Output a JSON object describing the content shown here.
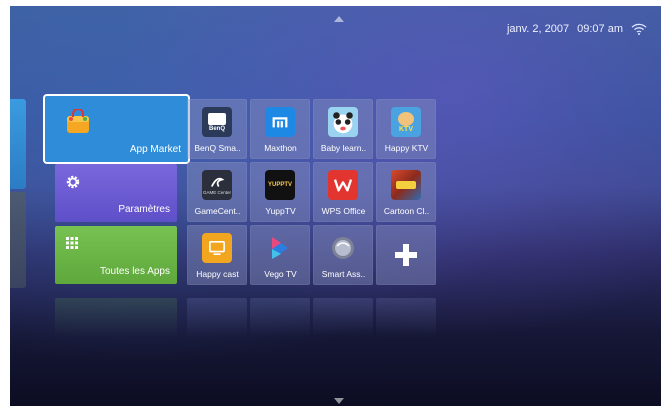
{
  "status_bar": {
    "date": "janv. 2, 2007",
    "time": "09:07 am",
    "wifi_icon": "wifi-icon"
  },
  "big_tiles": [
    {
      "label": "App Market",
      "icon": "shopping-bag-icon",
      "color": "#2f8cd8",
      "focused": true
    },
    {
      "label": "Paramètres",
      "icon": "gear-icon",
      "color": "#6a5cd6"
    },
    {
      "label": "Toutes les Apps",
      "icon": "grid-icon",
      "color": "#6ab547"
    }
  ],
  "apps": [
    {
      "label": "BenQ Sma..",
      "icon": "benq-icon",
      "icon_color": "#2c3a5a"
    },
    {
      "label": "Maxthon",
      "icon": "maxthon-icon",
      "icon_color": "#1e88e5"
    },
    {
      "label": "Baby learn..",
      "icon": "baby-learning-icon",
      "icon_color": "#f3c13a"
    },
    {
      "label": "Happy KTV",
      "icon": "ktv-icon",
      "icon_color": "#4aa3e0"
    },
    {
      "label": "GameCent..",
      "icon": "game-center-icon",
      "icon_color": "#2b2f3c"
    },
    {
      "label": "YuppTV",
      "icon": "yupptv-icon",
      "icon_color": "#1a1a1a"
    },
    {
      "label": "WPS Office",
      "icon": "wps-office-icon",
      "icon_color": "#e3352f"
    },
    {
      "label": "Cartoon Cl..",
      "icon": "cartoon-icon",
      "icon_color": "#3b2e25"
    },
    {
      "label": "Happy cast",
      "icon": "happy-cast-icon",
      "icon_color": "#f2a51e"
    },
    {
      "label": "Vego TV",
      "icon": "vego-tv-icon",
      "icon_color": "#2a7de1"
    },
    {
      "label": "Smart Ass..",
      "icon": "smart-assistant-icon",
      "icon_color": "#8a8fa6"
    },
    {
      "label": "",
      "icon": "add-icon",
      "icon_color": "#ffffff"
    }
  ],
  "benq_badge": "BenQ",
  "yupp_badge": "YUPPTV",
  "ktv_badge": "KTV",
  "game_badge": "GAME Center"
}
